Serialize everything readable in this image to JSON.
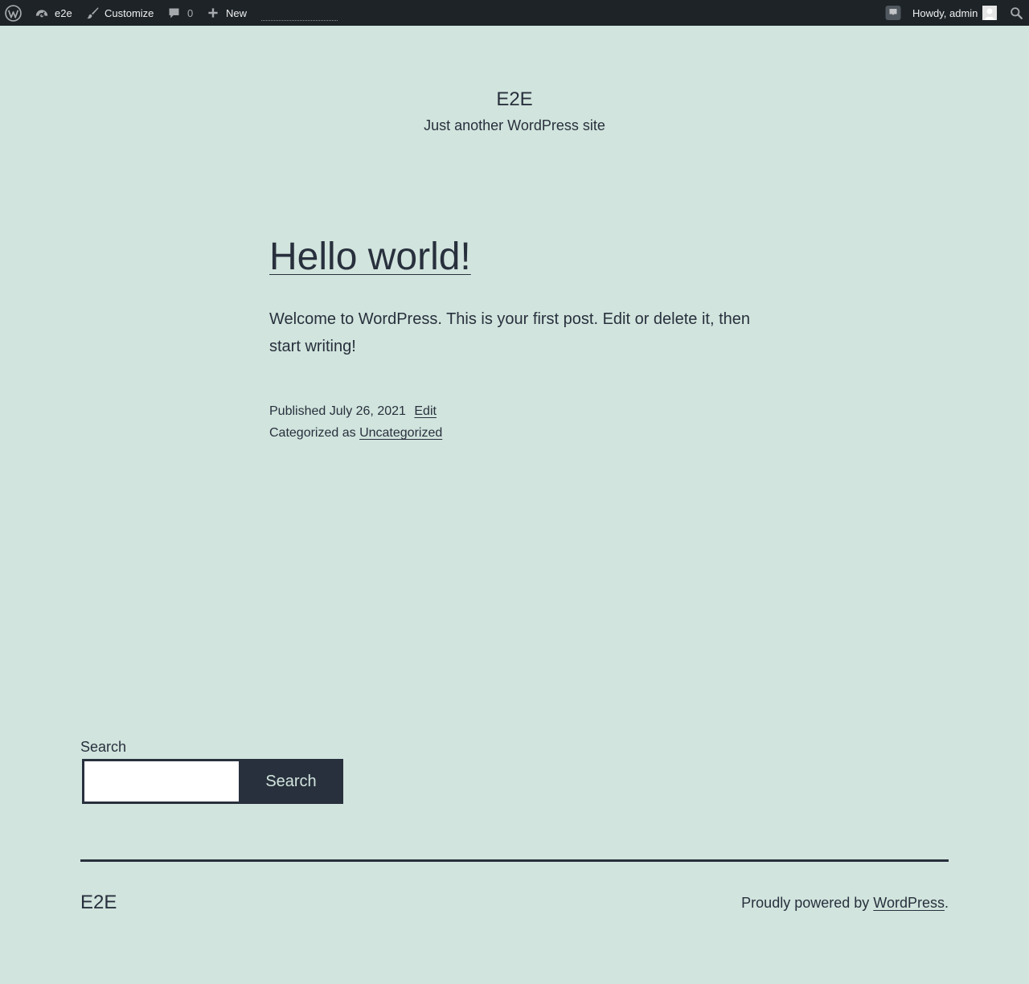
{
  "admin_bar": {
    "site_name": "e2e",
    "customize_label": "Customize",
    "comments_count": "0",
    "new_label": "New",
    "greeting": "Howdy, admin",
    "icons": {
      "wp_logo": "wordpress-logo-icon",
      "dashboard": "dashboard-icon",
      "customize": "paintbrush-icon",
      "comments": "comment-bubble-icon",
      "new": "plus-icon",
      "notifications": "notification-icon",
      "search": "search-icon"
    },
    "background_color": "#1d2327"
  },
  "header": {
    "site_title": "E2E",
    "tagline": "Just another WordPress site"
  },
  "post": {
    "title": "Hello world!",
    "content": "Welcome to WordPress. This is your first post. Edit or delete it, then start writing!",
    "published_prefix": "Published",
    "published_date": "July 26, 2021",
    "edit_label": "Edit",
    "categorized_prefix": "Categorized as",
    "category": "Uncategorized"
  },
  "search_widget": {
    "label": "Search",
    "input_value": "",
    "button_label": "Search"
  },
  "footer": {
    "site_title": "E2E",
    "powered_prefix": "Proudly powered by",
    "powered_link": "WordPress",
    "powered_suffix": "."
  },
  "colors": {
    "background": "#d1e4dd",
    "text": "#28303d"
  }
}
